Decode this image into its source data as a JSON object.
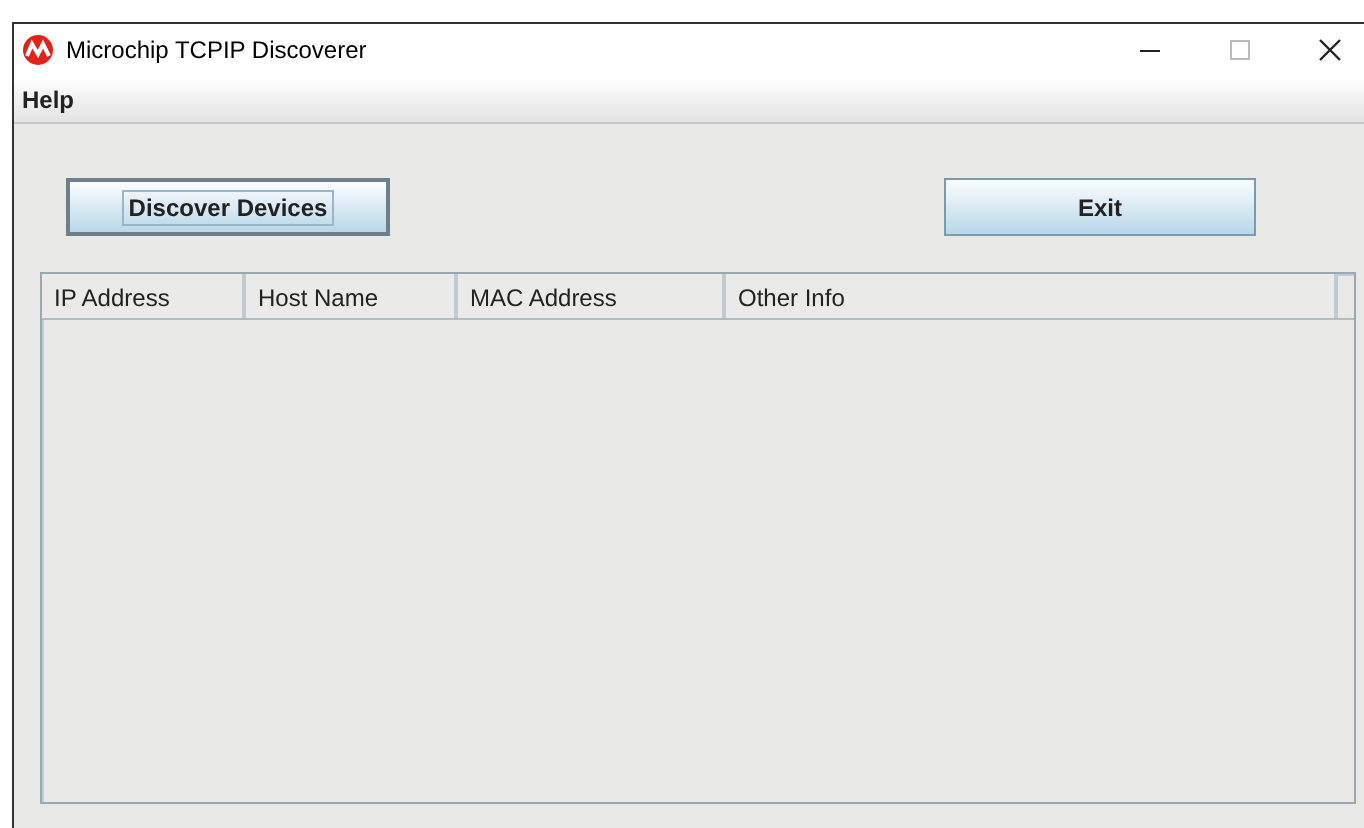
{
  "window": {
    "title": "Microchip TCPIP Discoverer"
  },
  "menu": [
    "Help"
  ],
  "buttons": [
    {
      "label": "Discover Devices",
      "focused": true
    },
    {
      "label": "Exit",
      "focused": false
    }
  ],
  "table": {
    "columns": [
      "IP Address",
      "Host Name",
      "MAC Address",
      "Other Info"
    ]
  }
}
